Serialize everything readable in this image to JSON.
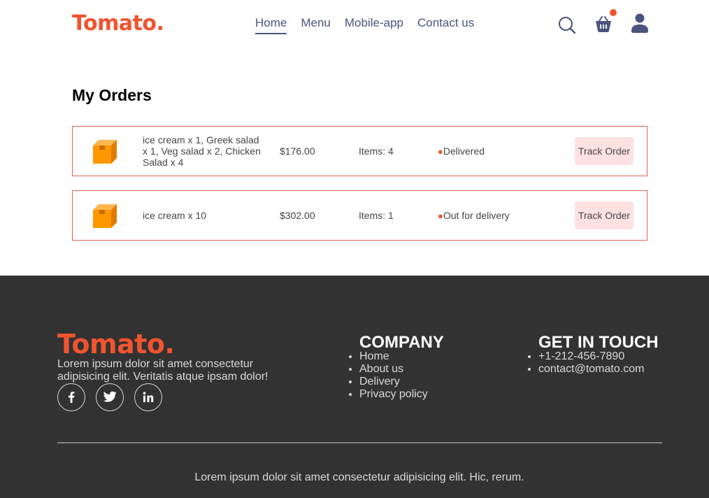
{
  "brand": {
    "logo_text": "Tomato.",
    "accent": "#f0542e"
  },
  "navbar": {
    "menu": [
      "Home",
      "Menu",
      "Mobile-app",
      "Contact us"
    ],
    "active_index": 0,
    "icons": [
      "search-icon",
      "basket-icon",
      "profile-icon"
    ]
  },
  "orders": {
    "title": "My Orders",
    "rows": [
      {
        "items": "ice cream x 1, Greek salad x 1, Veg salad x 2, Chicken Salad x 4",
        "amount": "$176.00",
        "count": "Items: 4",
        "status": "Delivered",
        "button": "Track Order"
      },
      {
        "items": "ice cream x 10",
        "amount": "$302.00",
        "count": "Items: 1",
        "status": "Out for delivery",
        "button": "Track Order"
      }
    ]
  },
  "footer": {
    "logo_text": "Tomato.",
    "description": "Lorem ipsum dolor sit amet consectetur adipisicing elit. Veritatis atque ipsam dolor!",
    "social": [
      "facebook-icon",
      "twitter-icon",
      "linkedin-icon"
    ],
    "company": {
      "heading": "COMPANY",
      "links": [
        "Home",
        "About us",
        "Delivery",
        "Privacy policy"
      ]
    },
    "contact": {
      "heading": "GET IN TOUCH",
      "items": [
        "+1-212-456-7890",
        "contact@tomato.com"
      ]
    },
    "copyright": "Lorem ipsum dolor sit amet consectetur adipisicing elit. Hic, rerum."
  }
}
